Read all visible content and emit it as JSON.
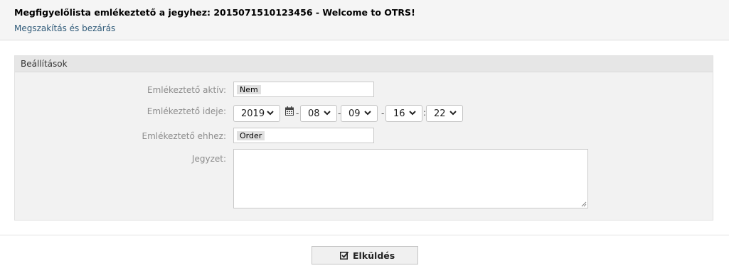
{
  "header": {
    "title": "Megfigyelőlista emlékeztető a jegyhez: 2015071510123456 - Welcome to OTRS!",
    "cancel_link": "Megszakítás és bezárás"
  },
  "panel": {
    "title": "Beállítások",
    "reminder_active": {
      "label": "Emlékeztető aktív:",
      "value": "Nem"
    },
    "reminder_time": {
      "label": "Emlékeztető ideje:",
      "year": "2019",
      "month": "08",
      "day": "09",
      "hour": "16",
      "minute": "22",
      "date_sep": "-",
      "time_sep": ":",
      "icons": {
        "calendar": "calendar-icon",
        "dropdown": "chevron-down-icon"
      }
    },
    "reminder_to": {
      "label": "Emlékeztető ehhez:",
      "value": "Order"
    },
    "note": {
      "label": "Jegyzet:",
      "value": ""
    }
  },
  "submit": {
    "label": "Elküldés",
    "icon": "check-square-icon"
  }
}
